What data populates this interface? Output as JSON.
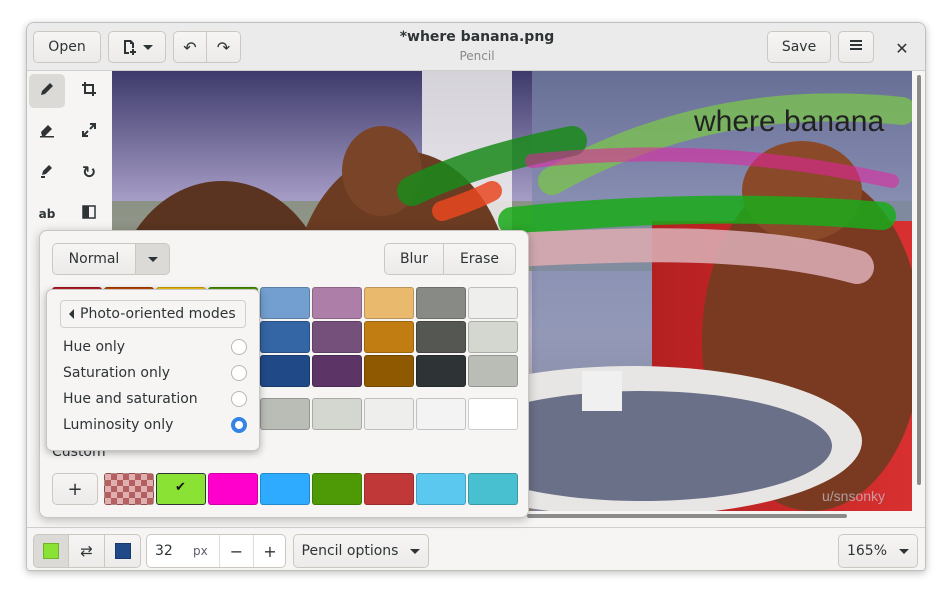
{
  "header": {
    "open_label": "Open",
    "title": "*where banana.png",
    "subtitle": "Pencil",
    "save_label": "Save"
  },
  "canvas": {
    "image_caption": "where banana",
    "watermark": "u/snsonky"
  },
  "popover": {
    "blend_mode": "Normal",
    "blur_label": "Blur",
    "erase_label": "Erase",
    "custom_label": "Custom",
    "add_label": "+"
  },
  "submenu": {
    "back_label": "Photo-oriented modes",
    "options": [
      {
        "label": "Hue only",
        "checked": false
      },
      {
        "label": "Saturation only",
        "checked": false
      },
      {
        "label": "Hue and saturation",
        "checked": false
      },
      {
        "label": "Luminosity only",
        "checked": true
      }
    ]
  },
  "palette": {
    "rows": [
      [
        "#c01c28",
        "#c64600",
        "#f5c211",
        "#4e9a06",
        "#729fcf",
        "#ad7fa8",
        "#e9b96e",
        "#888a85",
        "#eeeeec"
      ],
      [
        "#a51d2d",
        "#a04000",
        "#d0a000",
        "#3a7010",
        "#3465a4",
        "#75507b",
        "#c17d11",
        "#555753",
        "#d3d7cf"
      ],
      [
        "#7a1020",
        "#803000",
        "#a08000",
        "#2a5500",
        "#204a87",
        "#5c3566",
        "#8f5902",
        "#2e3436",
        "#babdb6"
      ],
      [
        "#000000",
        "#1c1c1c",
        "#5e5c64",
        "#9a9996",
        "#babdb6",
        "#d3d7cf",
        "#eeeeec",
        "#f3f3f3",
        "#ffffff"
      ]
    ],
    "custom": [
      "checker",
      "#8ae234",
      "#ff00cc",
      "#2eaaff",
      "#4e9a06",
      "#c03838",
      "#5bc8f0",
      "#48c0d0"
    ]
  },
  "bottombar": {
    "primary_color": "#8ae234",
    "secondary_color": "#204a87",
    "size_value": "32",
    "size_unit": "px",
    "minus_label": "−",
    "plus_label": "+",
    "tool_options_label": "Pencil options",
    "zoom_label": "165%"
  },
  "icons": [
    "new-image-icon",
    "undo-icon",
    "redo-icon",
    "menu-icon",
    "close-icon",
    "pencil-icon",
    "crop-icon",
    "eraser-icon",
    "scale-icon",
    "highlighter-icon",
    "rotate-icon",
    "text-icon",
    "filters-icon",
    "swap-icon",
    "checkmark-icon"
  ]
}
